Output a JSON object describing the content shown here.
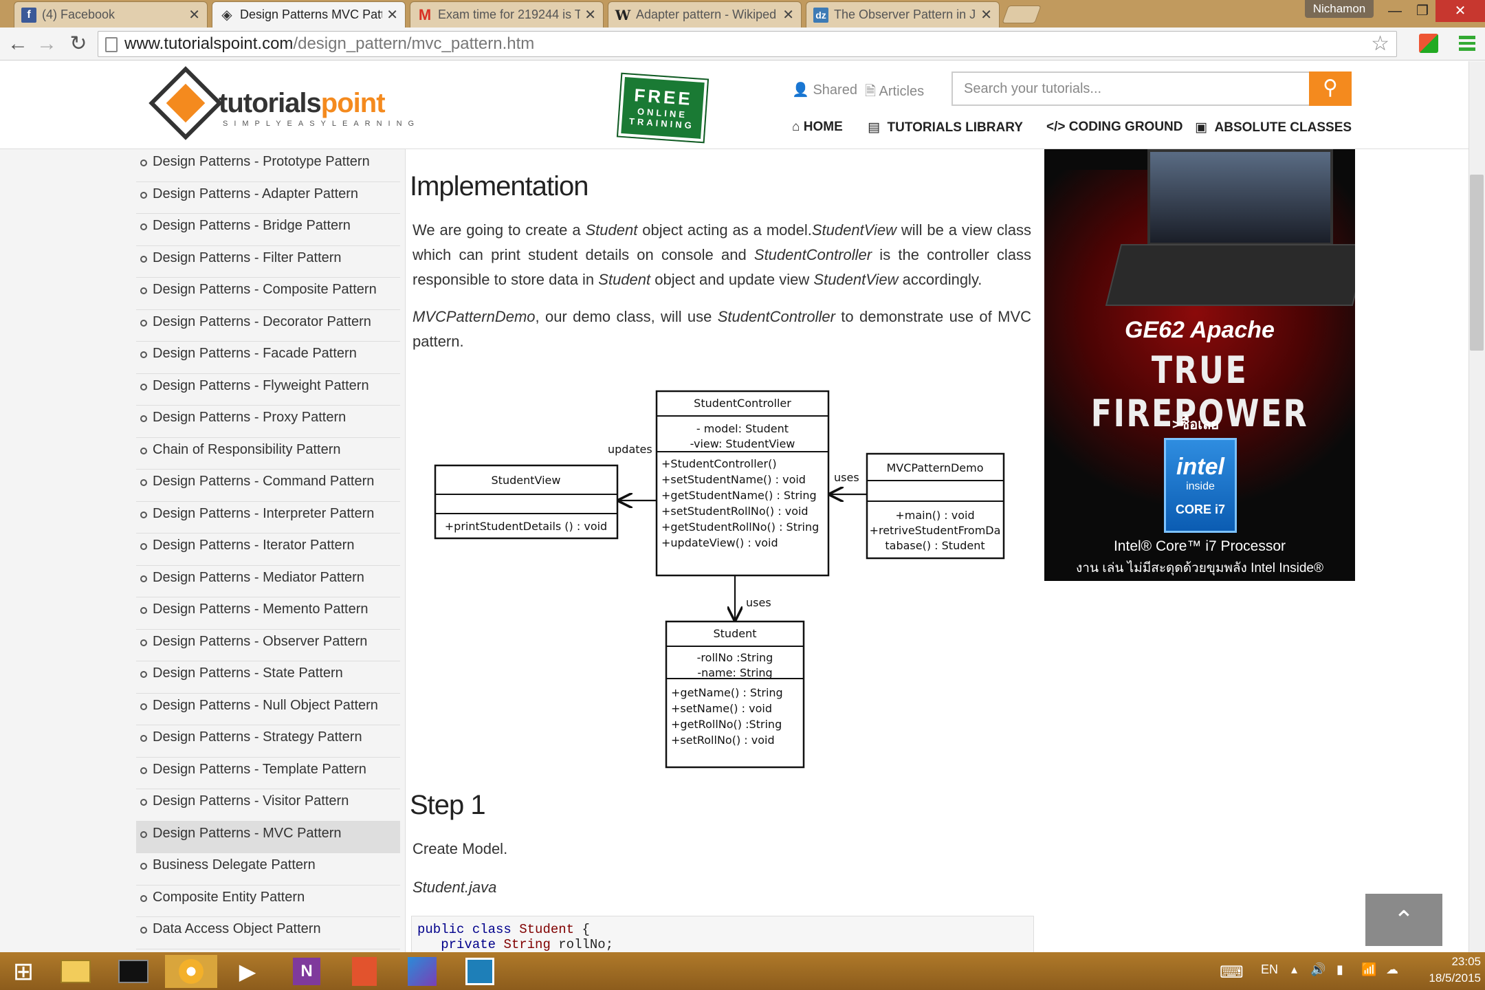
{
  "browser": {
    "tabs": [
      {
        "title": "(4) Facebook",
        "icon": "facebook-icon",
        "active": false
      },
      {
        "title": "Design Patterns MVC Patt",
        "icon": "tutorialspoint-icon",
        "active": true
      },
      {
        "title": "Exam time for 219244 is T",
        "icon": "gmail-icon",
        "active": false
      },
      {
        "title": "Adapter pattern - Wikiped",
        "icon": "wikipedia-icon",
        "active": false
      },
      {
        "title": "The Observer Pattern in Ja",
        "icon": "dzone-icon",
        "active": false
      }
    ],
    "profile": "Nichamon",
    "url_host": "www.tutorialspoint.com",
    "url_path": "/design_pattern/mvc_pattern.htm"
  },
  "header": {
    "logo_word_a": "tutorials",
    "logo_word_b": "point",
    "logo_tagline": "SIMPLYEASYLEARNING",
    "free_line1": "FREE",
    "free_line2": "ONLINE",
    "free_line3": "TRAINING",
    "shared": "Shared",
    "articles": "Articles",
    "search_placeholder": "Search your tutorials...",
    "nav": [
      "HOME",
      "TUTORIALS LIBRARY",
      "CODING GROUND",
      "ABSOLUTE CLASSES"
    ]
  },
  "sidebar": {
    "items": [
      "Design Patterns - Prototype Pattern",
      "Design Patterns - Adapter Pattern",
      "Design Patterns - Bridge Pattern",
      "Design Patterns - Filter Pattern",
      "Design Patterns - Composite Pattern",
      "Design Patterns - Decorator Pattern",
      "Design Patterns - Facade Pattern",
      "Design Patterns - Flyweight Pattern",
      "Design Patterns - Proxy Pattern",
      "Chain of Responsibility Pattern",
      "Design Patterns - Command Pattern",
      "Design Patterns - Interpreter Pattern",
      "Design Patterns - Iterator Pattern",
      "Design Patterns - Mediator Pattern",
      "Design Patterns - Memento Pattern",
      "Design Patterns - Observer Pattern",
      "Design Patterns - State Pattern",
      "Design Patterns - Null Object Pattern",
      "Design Patterns - Strategy Pattern",
      "Design Patterns - Template Pattern",
      "Design Patterns - Visitor Pattern",
      "Design Patterns - MVC Pattern",
      "Business Delegate Pattern",
      "Composite Entity Pattern",
      "Data Access Object Pattern"
    ],
    "selected_index": 21
  },
  "content": {
    "heading": "Implementation",
    "p1": {
      "a": "We are going to create a ",
      "b": "Student",
      "c": " object acting as a model.",
      "d": "StudentView",
      "e": " will be a view class which can print student details on console and ",
      "f": "StudentController",
      "g": " is the controller class responsible to store data in ",
      "h": "Student",
      "i": " object and update view ",
      "j": "StudentView",
      "k": " accordingly."
    },
    "p2": {
      "a": "MVCPatternDemo",
      "b": ", our demo class, will use ",
      "c": "StudentController",
      "d": " to demonstrate use of MVC pattern."
    },
    "step1_heading": "Step 1",
    "step1_text": "Create Model.",
    "file_name": "Student.java",
    "code_line1_kw": "public class",
    "code_line1_name": "Student",
    "code_line1_brace": "{",
    "code_line2_kw": "private",
    "code_line2_type": "String",
    "code_line2_rest": "rollNo;"
  },
  "uml": {
    "controller_name": "StudentController",
    "controller_attrs": [
      "- model: Student",
      "-view: StudentView"
    ],
    "controller_ops": [
      "+StudentController()",
      "+setStudentName()  : void",
      "+getStudentName()  : String",
      "+setStudentRollNo()  : void",
      "+getStudentRollNo()  : String",
      "+updateView()  : void"
    ],
    "view_name": "StudentView",
    "view_ops": [
      "+printStudentDetails  () : void"
    ],
    "demo_name": "MVCPatternDemo",
    "demo_ops": [
      "+main() : void",
      "+retriveStudentFromDa",
      "tabase() : Student"
    ],
    "student_name": "Student",
    "student_attrs": [
      "-rollNo  :String",
      "-name: String"
    ],
    "student_ops": [
      "+getName() : String",
      "+setName()  : void",
      "+getRollNo()  :String",
      "+setRollNo()  : void"
    ],
    "label_updates": "updates",
    "label_uses_right": "uses",
    "label_uses_bottom": "uses"
  },
  "ad": {
    "model": "GE62 Apache",
    "headline": "TRUE FIREPOWER",
    "cta": ">ซื้อเลย",
    "intel_brand": "intel",
    "intel_inside": "inside",
    "intel_core": "CORE i7",
    "processor": "Intel® Core™ i7 Processor",
    "thai_line": "งาน เล่น ไม่มีสะดุดด้วยขุมพลัง Intel Inside®"
  },
  "taskbar": {
    "lang": "EN",
    "time": "23:05",
    "date": "18/5/2015"
  }
}
